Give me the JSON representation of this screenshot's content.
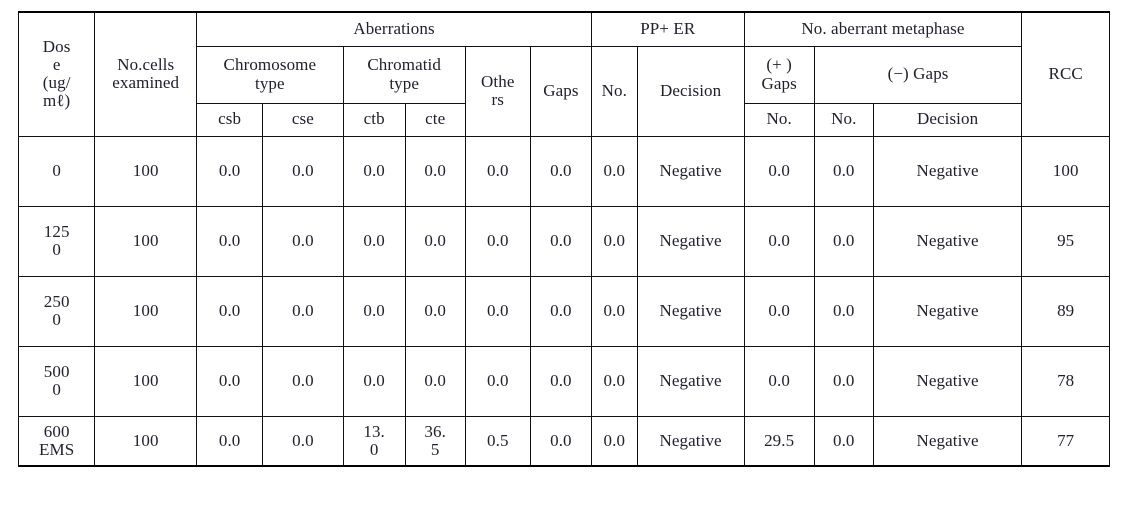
{
  "table": {
    "header": {
      "dose": "Dos\ne\n(ug/\nmℓ)",
      "cells_examined": "No.cells\nexamined",
      "aberrations": "Aberrations",
      "chromosome_type": "Chromosome\ntype",
      "chromatid_type": "Chromatid\ntype",
      "others": "Othe\nrs",
      "gaps": "Gaps",
      "pp_er": "PP+ ER",
      "pp_er_no": "No.",
      "pp_er_decision": "Decision",
      "no_aberrant_metaphase": "No.  aberrant    metaphase",
      "plus_gaps": "(+ )\nGaps",
      "minus_gaps": "(−) Gaps",
      "plus_gaps_no": "No.",
      "minus_gaps_no": "No.",
      "minus_gaps_decision": "Decision",
      "rcc": "RCC",
      "csb": "csb",
      "cse": "cse",
      "ctb": "ctb",
      "cte": "cte"
    },
    "columns": [
      "dose",
      "cells_examined",
      "csb",
      "cse",
      "ctb",
      "cte",
      "others",
      "gaps",
      "pp_er_no",
      "pp_er_decision",
      "plus_gaps_no",
      "minus_gaps_no",
      "minus_gaps_decision",
      "rcc"
    ],
    "rows": [
      {
        "dose": "0",
        "cells_examined": "100",
        "csb": "0.0",
        "cse": "0.0",
        "ctb": "0.0",
        "cte": "0.0",
        "others": "0.0",
        "gaps": "0.0",
        "pp_er_no": "0.0",
        "pp_er_decision": "Negative",
        "plus_gaps_no": "0.0",
        "minus_gaps_no": "0.0",
        "minus_gaps_decision": "Negative",
        "rcc": "100"
      },
      {
        "dose": "125\n0",
        "cells_examined": "100",
        "csb": "0.0",
        "cse": "0.0",
        "ctb": "0.0",
        "cte": "0.0",
        "others": "0.0",
        "gaps": "0.0",
        "pp_er_no": "0.0",
        "pp_er_decision": "Negative",
        "plus_gaps_no": "0.0",
        "minus_gaps_no": "0.0",
        "minus_gaps_decision": "Negative",
        "rcc": "95"
      },
      {
        "dose": "250\n0",
        "cells_examined": "100",
        "csb": "0.0",
        "cse": "0.0",
        "ctb": "0.0",
        "cte": "0.0",
        "others": "0.0",
        "gaps": "0.0",
        "pp_er_no": "0.0",
        "pp_er_decision": "Negative",
        "plus_gaps_no": "0.0",
        "minus_gaps_no": "0.0",
        "minus_gaps_decision": "Negative",
        "rcc": "89"
      },
      {
        "dose": "500\n0",
        "cells_examined": "100",
        "csb": "0.0",
        "cse": "0.0",
        "ctb": "0.0",
        "cte": "0.0",
        "others": "0.0",
        "gaps": "0.0",
        "pp_er_no": "0.0",
        "pp_er_decision": "Negative",
        "plus_gaps_no": "0.0",
        "minus_gaps_no": "0.0",
        "minus_gaps_decision": "Negative",
        "rcc": "78"
      },
      {
        "dose": "600\nEMS",
        "cells_examined": "100",
        "csb": "0.0",
        "cse": "0.0",
        "ctb": "13.\n0",
        "cte": "36.\n5",
        "others": "0.5",
        "gaps": "0.0",
        "pp_er_no": "0.0",
        "pp_er_decision": "Negative",
        "plus_gaps_no": "29.5",
        "minus_gaps_no": "0.0",
        "minus_gaps_decision": "Negative",
        "rcc": "77"
      }
    ]
  }
}
